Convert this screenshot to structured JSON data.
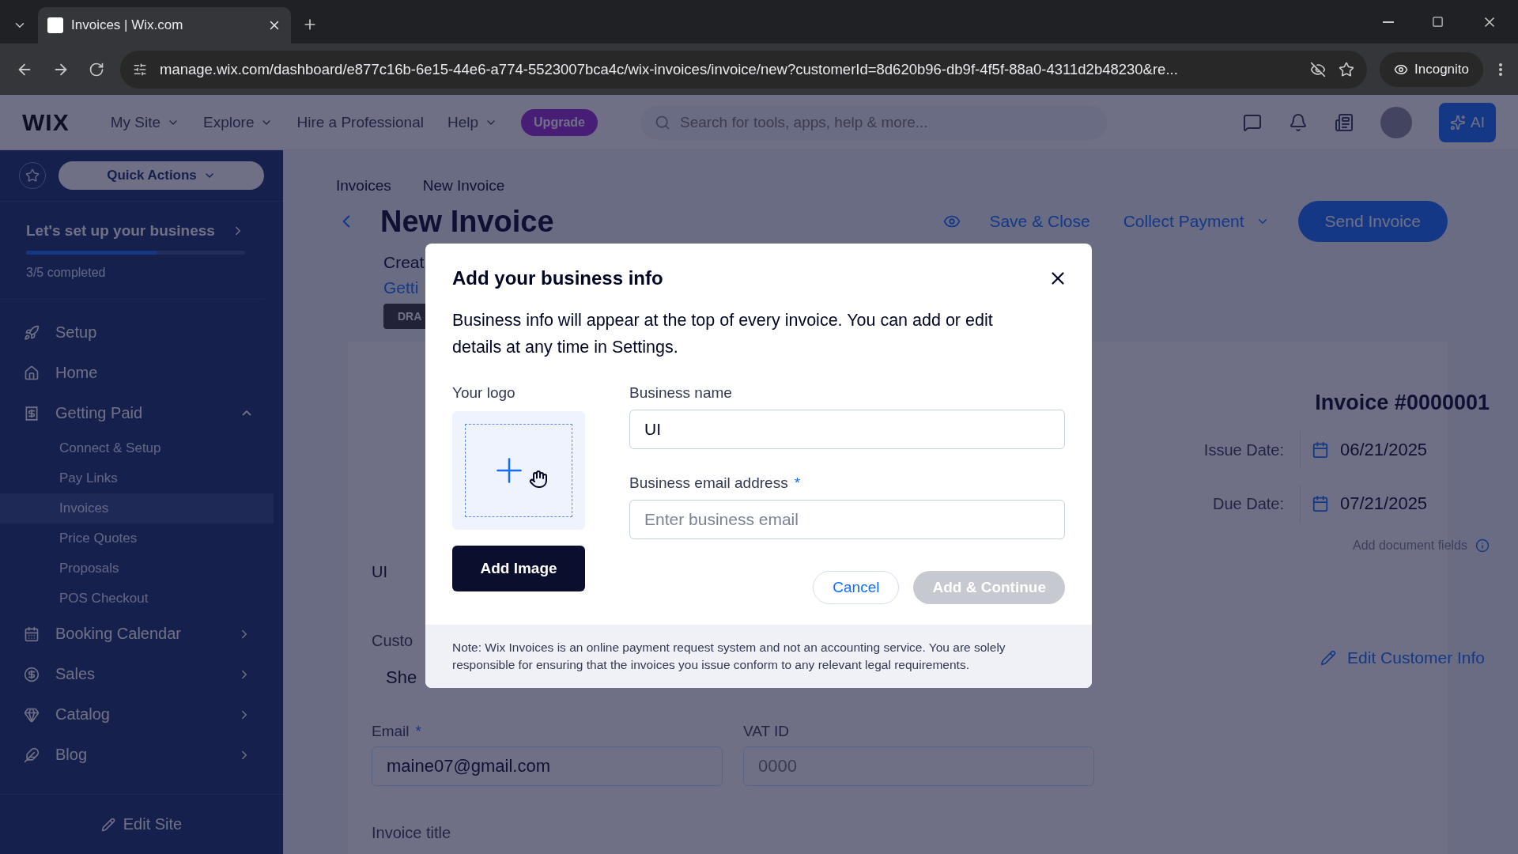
{
  "browser": {
    "tab_title": "Invoices | Wix.com",
    "url": "manage.wix.com/dashboard/e877c16b-6e15-44e6-a774-5523007bca4c/wix-invoices/invoice/new?customerId=8d620b96-db9f-4f5f-88a0-4311d2b48230&re...",
    "profile": "Incognito"
  },
  "topbar": {
    "logo": "WIX",
    "menus": [
      {
        "label": "My Site",
        "dropdown": true
      },
      {
        "label": "Explore",
        "dropdown": true
      },
      {
        "label": "Hire a Professional",
        "dropdown": false
      },
      {
        "label": "Help",
        "dropdown": true
      }
    ],
    "upgrade": "Upgrade",
    "search": {
      "placeholder": "Search for tools, apps, help & more..."
    },
    "ai": "AI"
  },
  "sidebar": {
    "quick_actions": "Quick Actions",
    "setup": {
      "title": "Let's set up your business",
      "level": 0.6,
      "progress": "3/5 completed"
    },
    "items": [
      {
        "label": "Setup",
        "has_chevron": false
      },
      {
        "label": "Home",
        "has_chevron": false
      },
      {
        "label": "Getting Paid",
        "expanded": true,
        "has_chevron": true,
        "children": [
          {
            "label": "Connect & Setup",
            "selected": false
          },
          {
            "label": "Pay Links",
            "selected": false
          },
          {
            "label": "Invoices",
            "selected": true
          },
          {
            "label": "Price Quotes",
            "selected": false
          },
          {
            "label": "Proposals",
            "selected": false
          },
          {
            "label": "POS Checkout",
            "selected": false
          }
        ]
      },
      {
        "label": "Booking Calendar",
        "expanded": false,
        "has_chevron": true
      },
      {
        "label": "Sales",
        "expanded": false,
        "has_chevron": true
      },
      {
        "label": "Catalog",
        "expanded": false,
        "has_chevron": true
      },
      {
        "label": "Blog",
        "expanded": false,
        "has_chevron": true
      }
    ],
    "edit_site": "Edit Site"
  },
  "page": {
    "breadcrumb": [
      "Invoices",
      "New Invoice"
    ],
    "title": "New Invoice",
    "subtitle": "Creat",
    "link": "Getti",
    "status": "DRA",
    "actions": {
      "save": "Save & Close",
      "collect": "Collect Payment",
      "send": "Send Invoice"
    },
    "invoice_number": "Invoice #0000001",
    "dates": [
      {
        "label": "Issue Date:",
        "value": "06/21/2025"
      },
      {
        "label": "Due Date:",
        "value": "07/21/2025"
      }
    ],
    "add_fields": "Add document fields",
    "business": "UI",
    "customer_label": "Custo",
    "customer_name": "She",
    "edit_customer": "Edit Customer Info",
    "email": {
      "label": "Email",
      "required_mark": "*",
      "value": "maine07@gmail.com"
    },
    "vat": {
      "label": "VAT ID",
      "placeholder": "0000"
    },
    "invoice_title": "Invoice title"
  },
  "modal": {
    "title": "Add your business info",
    "description": "Business info will appear at the top of every invoice. You can add or edit details at any time in Settings.",
    "logo_label": "Your logo",
    "add_image": "Add Image",
    "fields": [
      {
        "label": "Business name",
        "value": "UI"
      },
      {
        "label": "Business email address",
        "required_mark": "*",
        "placeholder": "Enter business email"
      }
    ],
    "cancel": "Cancel",
    "submit": {
      "label": "Add & Continue",
      "disabled": true
    },
    "note": "Note: Wix Invoices is an online payment request system and not an accounting service. You are solely responsible for ensuring that the invoices you issue conform to any relevant legal requirements."
  }
}
